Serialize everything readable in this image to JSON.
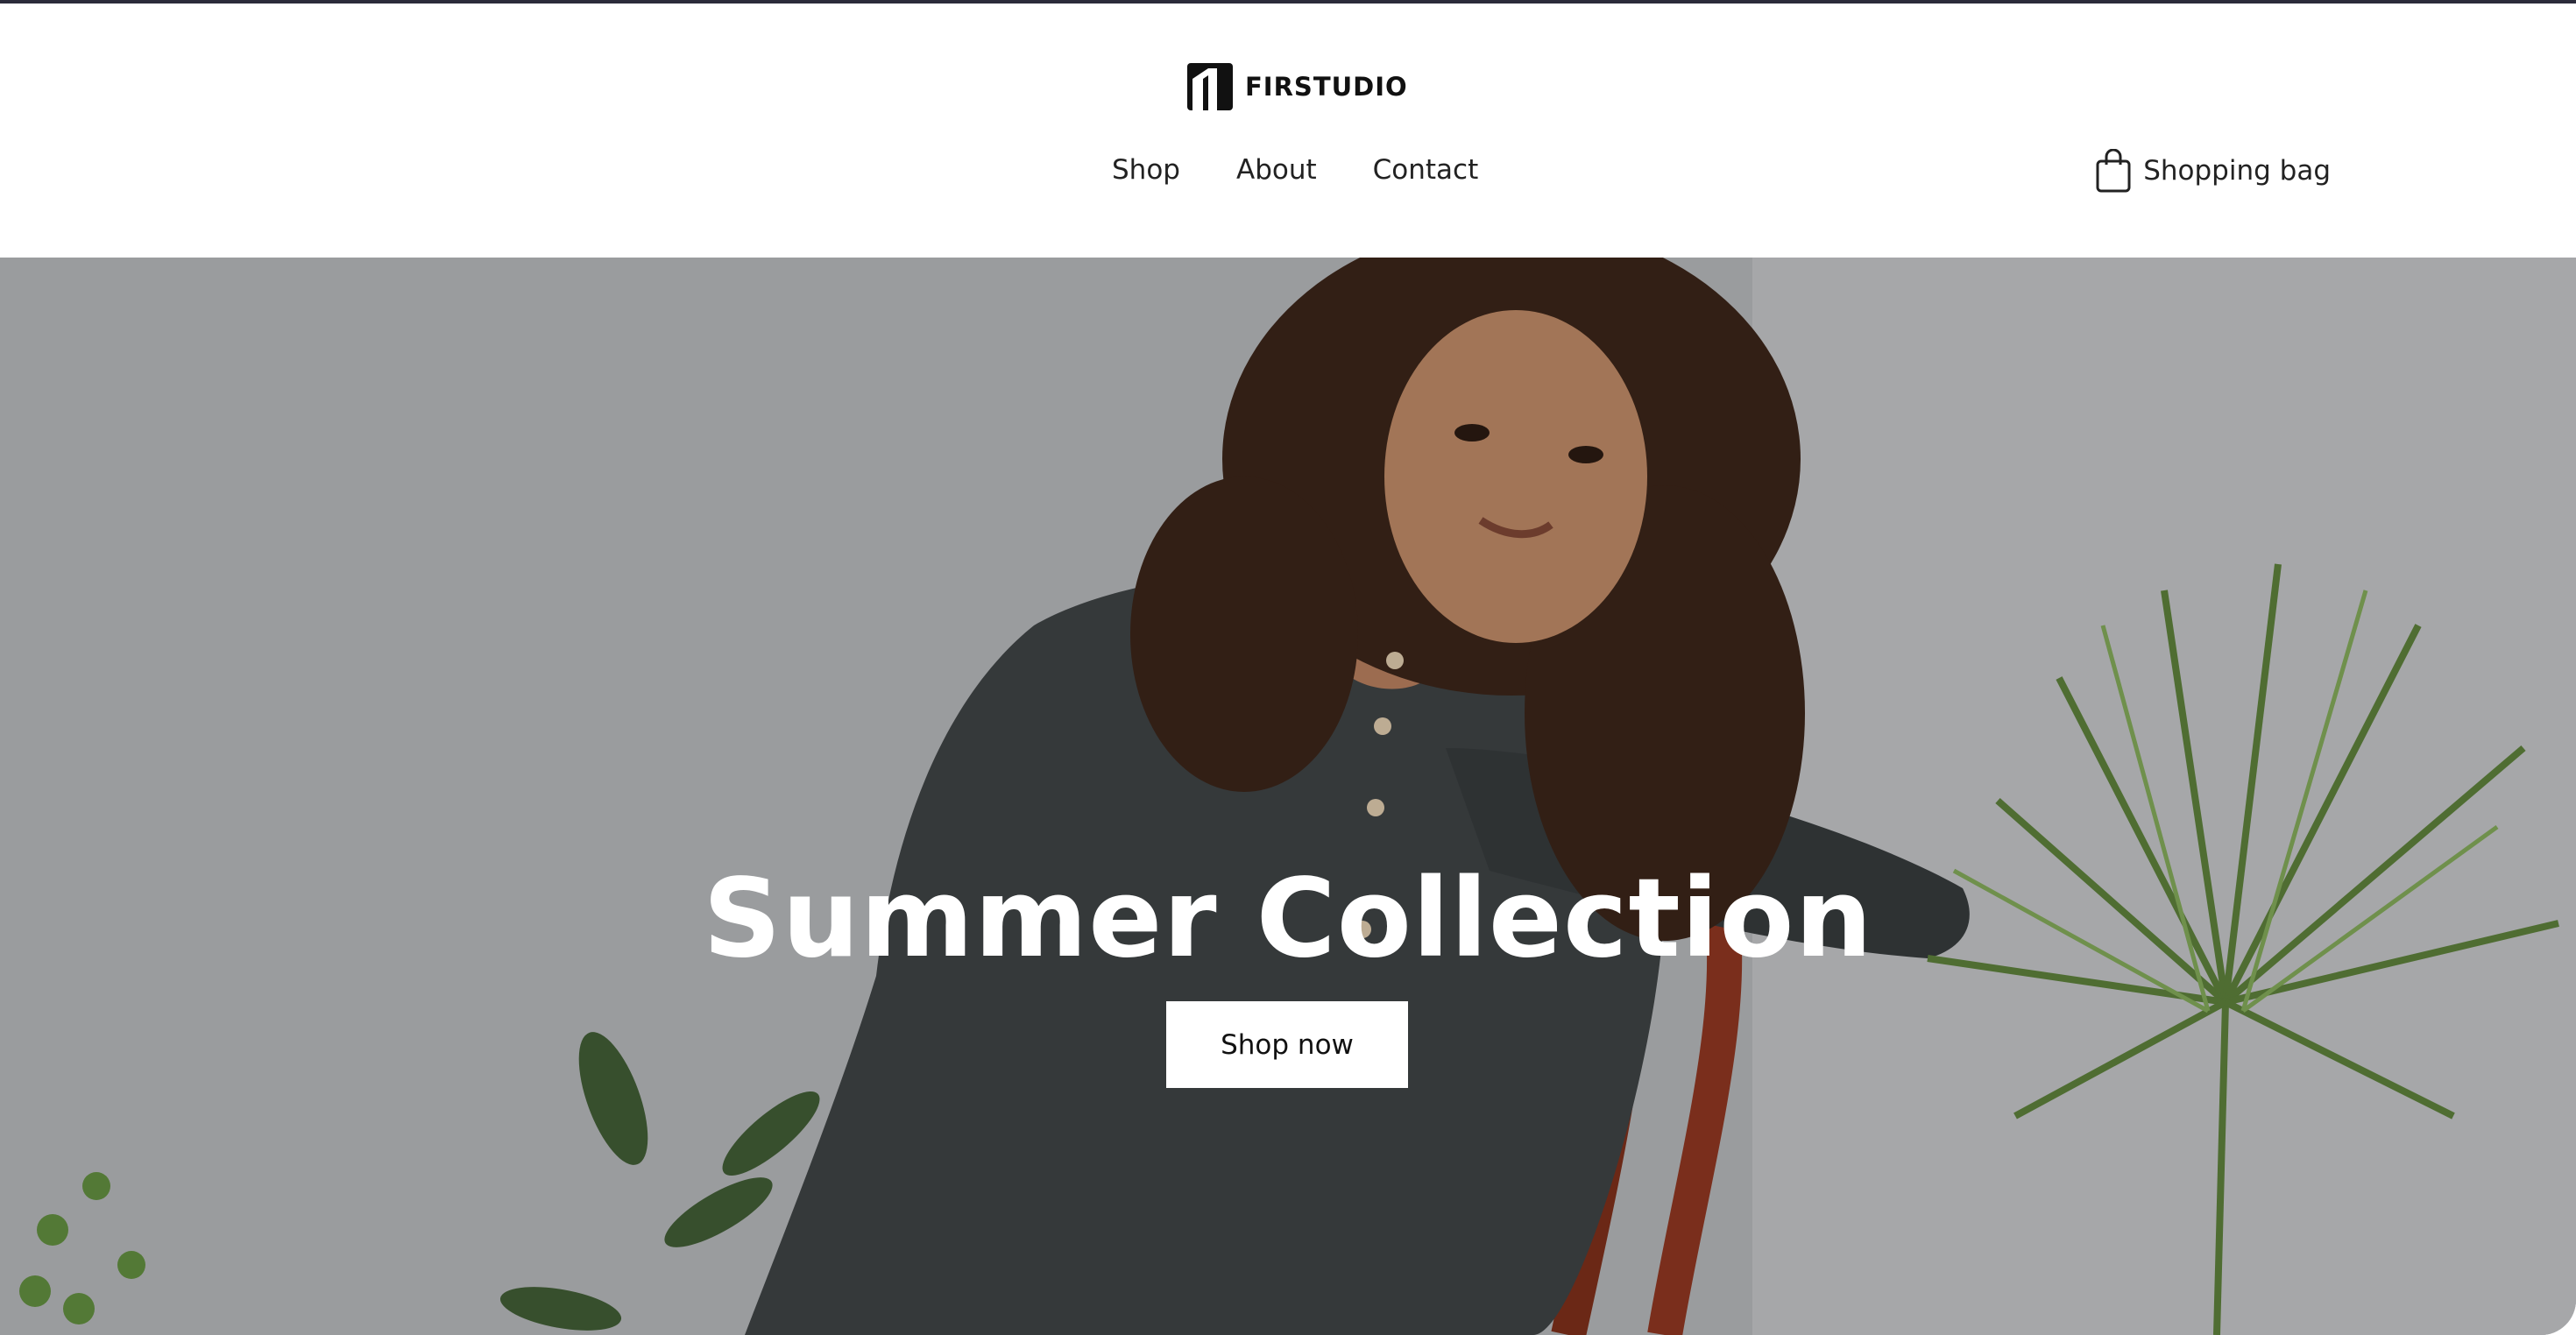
{
  "brand": {
    "name": "FIRSTUDIO"
  },
  "nav": {
    "items": [
      {
        "label": "Shop"
      },
      {
        "label": "About"
      },
      {
        "label": "Contact"
      }
    ]
  },
  "cart": {
    "label": "Shopping bag",
    "icon": "shopping-bag-icon"
  },
  "hero": {
    "title": "Summer Collection",
    "cta_label": "Shop now",
    "image": "woman-in-dark-dress-on-chair-with-plants"
  },
  "colors": {
    "background": "#ffffff",
    "text": "#222222",
    "hero_text": "#ffffff",
    "top_rule": "#2b2b3a"
  }
}
